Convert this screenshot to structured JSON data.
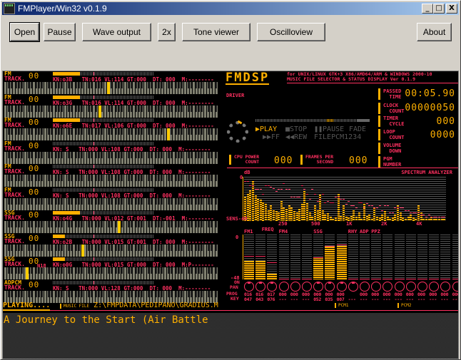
{
  "window": {
    "title": "FMPlayer/Win32 v0.1.9",
    "app_icon_text": "YM 2608",
    "controls": [
      "_",
      "□",
      "X"
    ]
  },
  "toolbar": {
    "open": "Open",
    "pause": "Pause",
    "wave_output": "Wave output",
    "double": "2x",
    "tone_viewer": "Tone viewer",
    "oscilloview": "Oscilloview",
    "about": "About"
  },
  "tracks": [
    {
      "type": "FM",
      "track_label": "TRACK.",
      "num": "00",
      "kn": "KN:o3B",
      "tn": "TN:016",
      "vl": "VL:114",
      "gt": "GT:000",
      "dt": "DT: 000",
      "m": "M:--------",
      "meter": 0.27,
      "key_pos": 0.48
    },
    {
      "type": "FM",
      "track_label": "TRACK.",
      "num": "00",
      "kn": "KN:o3G",
      "tn": "TN:016",
      "vl": "VL:114",
      "gt": "GT:000",
      "dt": "DT: 000",
      "m": "M:--------",
      "meter": 0.27,
      "key_pos": 0.44
    },
    {
      "type": "FM",
      "track_label": "TRACK.",
      "num": "00",
      "kn": "KN:o6E",
      "tn": "TN:017",
      "vl": "VL:106",
      "gt": "GT:000",
      "dt": "DT: 000",
      "m": "M:--------",
      "meter": 0.27,
      "key_pos": 0.76
    },
    {
      "type": "FM",
      "track_label": "TRACK.",
      "num": "00",
      "kn": "KN: S",
      "tn": "TN:000",
      "vl": "VL:108",
      "gt": "GT:000",
      "dt": "DT: 000",
      "m": "M:--------",
      "meter": 0.0,
      "key_pos": null
    },
    {
      "type": "FM",
      "track_label": "TRACK.",
      "num": "00",
      "kn": "KN: S",
      "tn": "TN:000",
      "vl": "VL:108",
      "gt": "GT:000",
      "dt": "DT: 000",
      "m": "M:--------",
      "meter": 0.0,
      "key_pos": null
    },
    {
      "type": "FM",
      "track_label": "TRACK.",
      "num": "00",
      "kn": "KN: S",
      "tn": "TN:000",
      "vl": "VL:108",
      "gt": "GT:000",
      "dt": "DT: 000",
      "m": "M:--------",
      "meter": 0.0,
      "key_pos": null
    },
    {
      "type": "SSG",
      "track_label": "TRACK.",
      "num": "00",
      "kn": "KN:o4G",
      "tn": "TN:000",
      "vl": "VL:012",
      "gt": "GT:001",
      "dt": "DT:-001",
      "m": "M:--------",
      "meter": 0.27,
      "key_pos": 0.53
    },
    {
      "type": "SSG",
      "track_label": "TRACK.",
      "num": "00",
      "kn": "KN:o2B",
      "tn": "TN:000",
      "vl": "VL:015",
      "gt": "GT:001",
      "dt": "DT: 000",
      "m": "M:--------",
      "meter": 0.12,
      "key_pos": 0.36
    },
    {
      "type": "SSG",
      "track_label": "TRACK.",
      "num": "00",
      "extra": "N18",
      "kn": "KN:o0G",
      "tn": "TN:000",
      "vl": "VL:015",
      "gt": "GT:000",
      "dt": "DT: 000",
      "m": "M:P-------",
      "meter": 0.12,
      "key_pos": 0.1
    },
    {
      "type": "ADPCM",
      "track_label": "TRACK.",
      "num": "00",
      "kn": "KN: S",
      "tn": "TN:000",
      "vl": "VL:128",
      "gt": "GT:000",
      "dt": "DT: 000",
      "m": "M:--------",
      "meter": 0.0,
      "key_pos": null
    }
  ],
  "fmdsp": {
    "logo": "FMDSP",
    "subtitle_1": "for UNIX/LINUX GTK+3 X86/AMD64/ARM & WINDOWS 2000-10",
    "subtitle_2": "MUSIC FILE SELECTOR & STATUS DISPLAY Ver 0.1.9",
    "driver_label": "DRIVER",
    "passed_time_label": "PASSED\n  TIME",
    "passed_time": "00:05.90",
    "clock_count_label": "CLOCK\n  COUNT",
    "clock_count": "00000050",
    "timer_cycle_label": "TIMER\n  CYCLE",
    "timer_cycle": "000",
    "loop_count_label": "LOOP\n  COUNT",
    "loop_count": "0000",
    "volume_down_label": "VOLUME\n  DOWN",
    "pgm_number_label": "PGM\nNUMBER",
    "cpu_power_label": "CPU POWER\n    COUNT",
    "cpu_power": "000",
    "fps_label": "FRAMES PER\n    SECOND",
    "fps": "000"
  },
  "transport": {
    "play": "▶PLAY",
    "stop": "■STOP",
    "pause": "❚❚PAUSE",
    "fade": "FADE",
    "ff": "▶▶FF",
    "rew": "◀◀REW",
    "filepcm": "FILEPCM1234",
    "progress": 0.65
  },
  "spectrum": {
    "title": "SPECTRUM ANALYZER",
    "db_label": "dB",
    "zero_label": "0",
    "sens_label": "SENS-48",
    "freq_label": "FREQ",
    "freq_ticks": [
      "250",
      "500",
      "1K",
      "2K",
      "4K"
    ],
    "levels": [
      0.55,
      0.62,
      0.7,
      0.9,
      0.58,
      0.5,
      0.48,
      0.42,
      0.38,
      0.25,
      0.35,
      0.25,
      0.22,
      0.2,
      0.45,
      0.3,
      0.28,
      0.35,
      0.3,
      0.22,
      0.2,
      0.28,
      0.38,
      0.68,
      0.4,
      0.2,
      0.1,
      0.35,
      0.25,
      0.6,
      0.25,
      0.15,
      0.18,
      0.1,
      0.05,
      0.08,
      0.62,
      0.12,
      0.35,
      0.1,
      0.08,
      0.12,
      0.25,
      0.1,
      0.2,
      0.05,
      0.38,
      0.12,
      0.15,
      0.05,
      0.3,
      0.1,
      0.08,
      0.15,
      0.22,
      0.1,
      0.05,
      0.08,
      0.15,
      0.35,
      0.2,
      0.08,
      0.05,
      0.1,
      0.15,
      0.08,
      0.05,
      0.35,
      0.2,
      0.05,
      0.05,
      0.05,
      0.1,
      0.05,
      0.05,
      0.05,
      0.05,
      0.05
    ],
    "peaks": [
      0.9,
      0.9,
      0.8,
      0.8,
      0.72,
      0.72,
      0.72,
      0.62,
      0.8,
      0.8,
      0.78,
      0.75,
      0.68,
      0.72,
      0.72,
      0.85,
      0.72,
      0.72,
      0.55,
      0.55,
      0.55,
      0.55,
      0.8,
      0.72,
      0.62,
      0.5,
      0.72,
      0.62,
      0.45,
      0.5,
      0.62,
      0.42,
      0.45,
      0.42,
      0.42,
      0.55,
      0.55,
      0.5,
      0.5,
      0.38,
      0.45,
      0.35,
      0.35,
      0.3,
      0.42,
      0.42,
      0.3,
      0.4,
      0.35,
      0.35,
      0.3,
      0.3,
      0.35,
      0.25,
      0.35,
      0.35,
      0.2,
      0.2,
      0.3,
      0.3,
      0.3,
      0.3,
      0.25,
      0.25,
      0.2,
      0.2,
      0.2,
      0.2,
      0.15,
      0.15,
      0.1,
      0.15,
      0.1,
      0.1,
      0.1,
      0.1,
      0.1,
      0.1
    ]
  },
  "channels": {
    "labels": [
      {
        "text": "FM1",
        "col": 0
      },
      {
        "text": "FM4",
        "col": 3
      },
      {
        "text": "SSG",
        "col": 6
      },
      {
        "text": "RHY",
        "col": 9
      },
      {
        "text": "ADP",
        "col": 10
      },
      {
        "text": "PPZ",
        "col": 11
      }
    ],
    "zero_label": "0",
    "min_label": "-48",
    "on_label": "ON",
    "pan_label": "PAN",
    "prog_label": "PROG",
    "key_label": "KEY",
    "levels": [
      0.42,
      0.42,
      0.12,
      0,
      0,
      0,
      0.5,
      0.73,
      0.75,
      0,
      0,
      0,
      0,
      0,
      0,
      0,
      0,
      0,
      0
    ],
    "peaks": [
      0.53,
      0.53,
      0.38,
      0,
      0,
      0,
      0.5,
      0.75,
      0.78,
      0,
      0,
      0,
      0,
      0,
      0,
      0,
      0,
      0,
      0
    ],
    "on": [
      true,
      true,
      true,
      false,
      false,
      false,
      true,
      true,
      true,
      true,
      false,
      false,
      false,
      false,
      false,
      false,
      false,
      false,
      false
    ],
    "prog": [
      "016",
      "016",
      "017",
      "000",
      "000",
      "000",
      "000",
      "000",
      "000",
      "",
      "000",
      "000",
      "000",
      "000",
      "000",
      "000",
      "000",
      "000",
      "000"
    ],
    "key": [
      "047",
      "043",
      "076",
      "---",
      "---",
      "---",
      "052",
      "035",
      "007",
      "---",
      "---",
      "---",
      "---",
      "---",
      "---",
      "---",
      "---",
      "---",
      "---"
    ]
  },
  "status": {
    "playing": "PLAYING....",
    "music_file_label": "MUSIC FILE",
    "music_file": "Z:\\FMPDATA\\PEDIPANO\\GRADIUS.M",
    "pcm1_label": "PCM1",
    "pcm2_label": "PCM2"
  },
  "lyric": "A Journey to the Start (Air Battle"
}
